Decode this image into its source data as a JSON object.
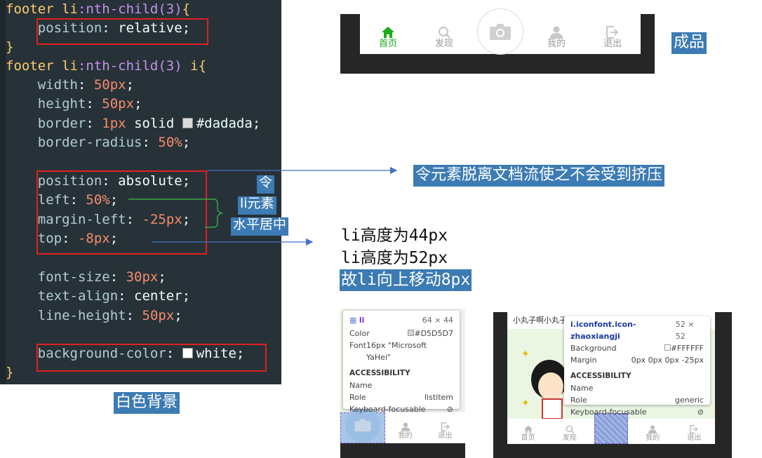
{
  "code": {
    "l1": {
      "sel": "footer li",
      "pseudo": ":nth-child",
      "arg": "(3)",
      "brace": "{"
    },
    "l2": {
      "prop": "position",
      "val": "relative"
    },
    "l3": {
      "brace": "}"
    },
    "l4": {
      "sel": "footer li",
      "pseudo": ":nth-child",
      "arg": "(3)",
      "el": "i",
      "brace": "{"
    },
    "width": {
      "prop": "width",
      "num": "50px"
    },
    "height": {
      "prop": "height",
      "num": "50px"
    },
    "border": {
      "prop": "border",
      "num": "1px",
      "kw": "solid",
      "color": "#dadada",
      "swatch": "#dadada"
    },
    "radius": {
      "prop": "border-radius",
      "num": "50%"
    },
    "position": {
      "prop": "position",
      "val": "absolute"
    },
    "left": {
      "prop": "left",
      "num": "50%"
    },
    "margin": {
      "prop": "margin-left",
      "num": "-25px"
    },
    "top": {
      "prop": "top",
      "num": "-8px"
    },
    "fontsize": {
      "prop": "font-size",
      "num": "30px"
    },
    "align": {
      "prop": "text-align",
      "val": "center"
    },
    "lineheight": {
      "prop": "line-height",
      "num": "50px"
    },
    "bg": {
      "prop": "background-color",
      "val": "white",
      "swatch": "#ffffff"
    },
    "close": {
      "brace": "}"
    }
  },
  "annotations": {
    "finished": "成品",
    "detach": "令元素脱离文档流使之不会受到挤压",
    "center1": "令",
    "center2": "li元素",
    "center3": "水平居中",
    "li_h1": "li高度为44px",
    "li_h2": "li高度为52px",
    "li_move": "故li向上移动8px",
    "white_bg": "白色背景"
  },
  "tabs": [
    {
      "label": "首页",
      "icon": "home-icon",
      "active": true
    },
    {
      "label": "发现",
      "icon": "search-icon"
    },
    {
      "label": "",
      "icon": "camera-icon"
    },
    {
      "label": "我的",
      "icon": "user-icon"
    },
    {
      "label": "退出",
      "icon": "logout-icon"
    }
  ],
  "tip1": {
    "tag": "li",
    "size": "64 × 44",
    "color_label": "Color",
    "color_val": "#D5D5D7",
    "font_label": "Font",
    "font_val": "16px \"Microsoft YaHei\"",
    "acc": "ACCESSIBILITY",
    "name_label": "Name",
    "name_val": "",
    "role_label": "Role",
    "role_val": "listitem",
    "kb_label": "Keyboard-focusable"
  },
  "tip2": {
    "tag": "i.iconfont.icon-zhaoxiangji",
    "size": "52 × 52",
    "bg_label": "Background",
    "bg_val": "#FFFFFF",
    "margin_label": "Margin",
    "margin_val": "0px 0px 0px -25px",
    "acc": "ACCESSIBILITY",
    "name_label": "Name",
    "name_val": "",
    "role_label": "Role",
    "role_val": "generic",
    "kb_label": "Keyboard-focusable"
  },
  "phone2_top_text": "小丸子啊小丸子",
  "colors": {
    "active": "#1aad19",
    "inactive": "#9a9a9a",
    "label_bg": "#3c7bb4",
    "red": "#e02020",
    "code_bg": "#263238"
  }
}
